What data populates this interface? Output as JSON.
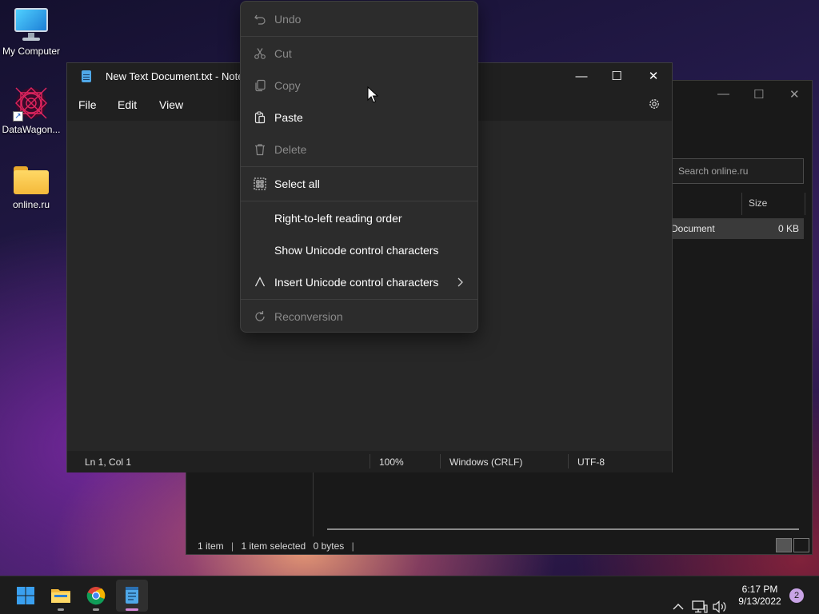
{
  "desktop": {
    "icons": [
      {
        "label": "My Computer"
      },
      {
        "label": "DataWagon..."
      },
      {
        "label": "online.ru"
      }
    ]
  },
  "explorer": {
    "search_placeholder": "Search online.ru",
    "columns": {
      "size": "Size"
    },
    "row": {
      "type": "Document",
      "size": "0 KB"
    },
    "status": {
      "items": "1 item",
      "selected": "1 item selected",
      "bytes": "0 bytes"
    }
  },
  "notepad": {
    "title": "New Text Document.txt - Notep",
    "menu": {
      "file": "File",
      "edit": "Edit",
      "view": "View"
    },
    "status": {
      "position": "Ln 1, Col 1",
      "zoom": "100%",
      "line_ending": "Windows (CRLF)",
      "encoding": "UTF-8"
    }
  },
  "context_menu": {
    "undo": "Undo",
    "cut": "Cut",
    "copy": "Copy",
    "paste": "Paste",
    "delete": "Delete",
    "select_all": "Select all",
    "rtl": "Right-to-left reading order",
    "show_unicode": "Show Unicode control characters",
    "insert_unicode": "Insert Unicode control characters",
    "reconversion": "Reconversion"
  },
  "taskbar": {
    "clock_time": "6:17 PM",
    "clock_date": "9/13/2022",
    "notification_count": "2"
  },
  "colors": {
    "accent": "#4fa8e8",
    "menu_bg": "#2c2c2c",
    "disabled_text": "#8a8a8a"
  }
}
